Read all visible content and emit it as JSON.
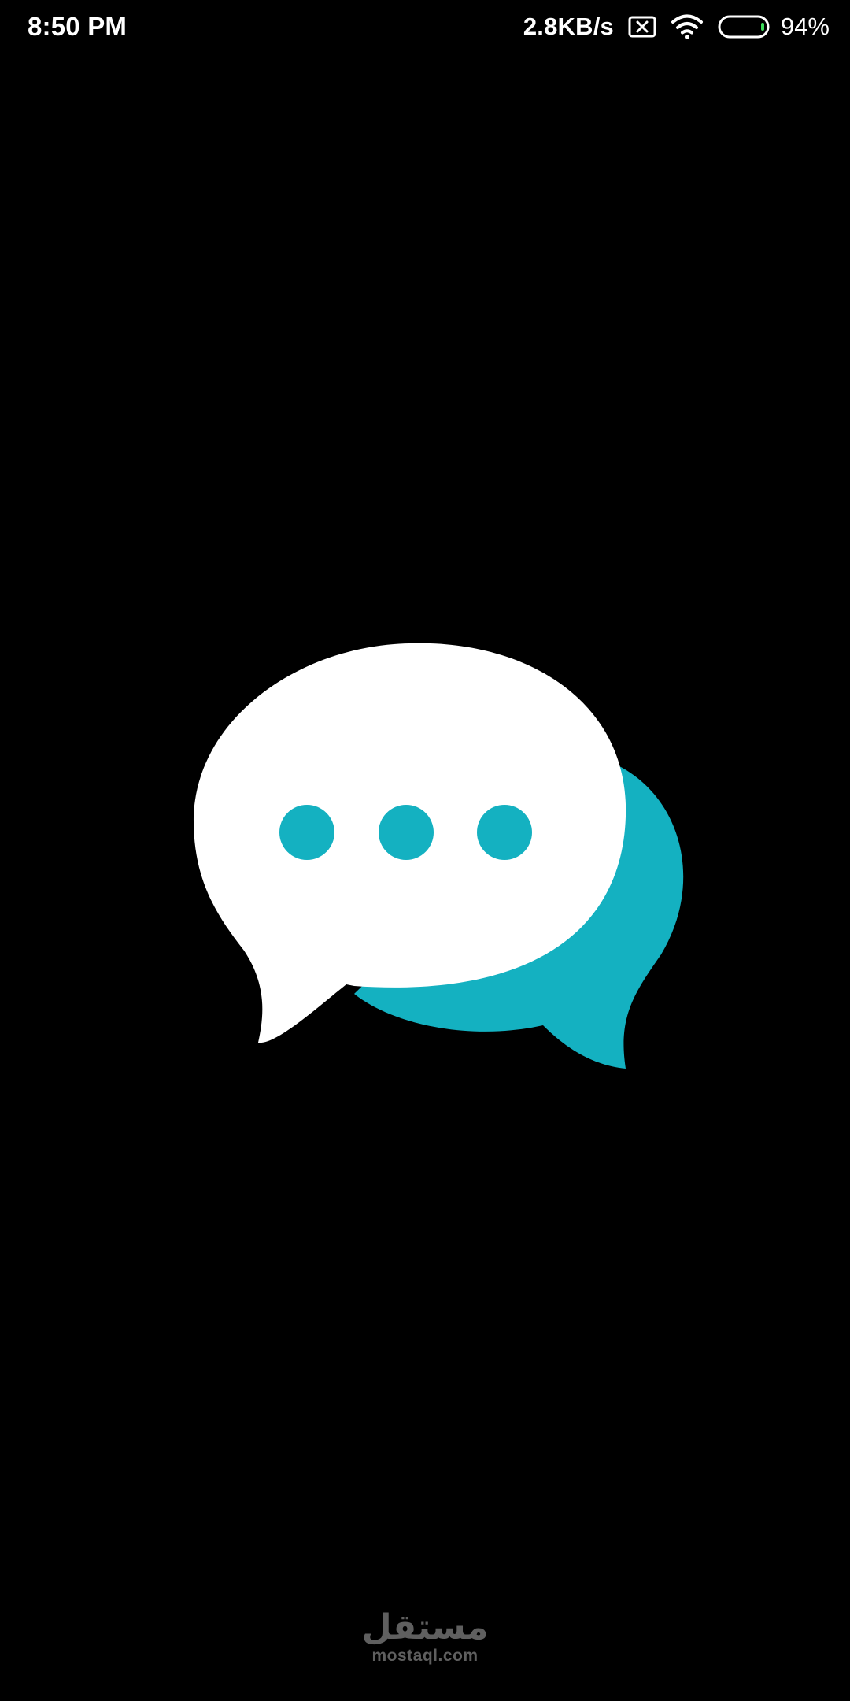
{
  "status_bar": {
    "time": "8:50 PM",
    "network_speed": "2.8KB/s",
    "battery_percent": "94%",
    "icons": [
      "no-sim-icon",
      "wifi-icon",
      "battery-icon"
    ]
  },
  "splash": {
    "logo": "chat-bubbles-icon",
    "colors": {
      "background": "#000000",
      "front_bubble": "#ffffff",
      "back_bubble": "#14b1c1",
      "dots": "#14b1c1"
    }
  },
  "watermark": {
    "arabic": "مستقل",
    "latin": "mostaql.com"
  }
}
